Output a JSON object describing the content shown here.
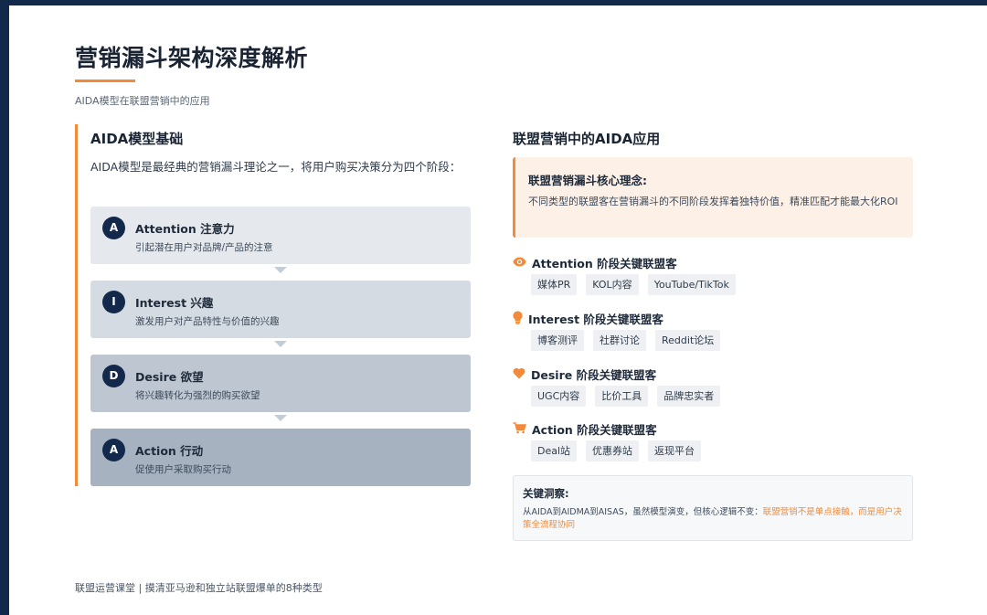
{
  "colors": {
    "accent": "#f28a3a",
    "navy": "#13294b"
  },
  "header": {
    "title": "营销漏斗架构深度解析",
    "subtitle": "AIDA模型在联盟营销中的应用"
  },
  "left": {
    "heading": "AIDA模型基础",
    "intro": "AIDA模型是最经典的营销漏斗理论之一，将用户购买决策分为四个阶段：",
    "stages": [
      {
        "letter": "A",
        "title": "Attention 注意力",
        "desc": "引起潜在用户对品牌/产品的注意"
      },
      {
        "letter": "I",
        "title": "Interest 兴趣",
        "desc": "激发用户对产品特性与价值的兴趣"
      },
      {
        "letter": "D",
        "title": "Desire 欲望",
        "desc": "将兴趣转化为强烈的购买欲望"
      },
      {
        "letter": "A",
        "title": "Action 行动",
        "desc": "促使用户采取购买行动"
      }
    ]
  },
  "right": {
    "heading": "联盟营销中的AIDA应用",
    "core": {
      "title": "联盟营销漏斗核心理念:",
      "text": "不同类型的联盟客在营销漏斗的不同阶段发挥着独特价值，精准匹配才能最大化ROI"
    },
    "stages": [
      {
        "icon": "eye-icon",
        "title": "Attention 阶段关键联盟客",
        "tags": [
          "媒体PR",
          "KOL内容",
          "YouTube/TikTok"
        ]
      },
      {
        "icon": "lightbulb-icon",
        "title": "Interest 阶段关键联盟客",
        "tags": [
          "博客测评",
          "社群讨论",
          "Reddit论坛"
        ]
      },
      {
        "icon": "heart-icon",
        "title": "Desire 阶段关键联盟客",
        "tags": [
          "UGC内容",
          "比价工具",
          "品牌忠实者"
        ]
      },
      {
        "icon": "cart-icon",
        "title": "Action 阶段关键联盟客",
        "tags": [
          "Deal站",
          "优惠券站",
          "返现平台"
        ]
      }
    ],
    "insight": {
      "title": "关键洞察:",
      "text_plain": "从AIDA到AIDMA到AISAS，虽然模型演变，但核心逻辑不变：",
      "text_highlight": "联盟营销不是单点接触，而是用户决策全流程协同"
    }
  },
  "footer": {
    "text": "联盟运营课堂 | 摸清亚马逊和独立站联盟爆单的8种类型"
  }
}
